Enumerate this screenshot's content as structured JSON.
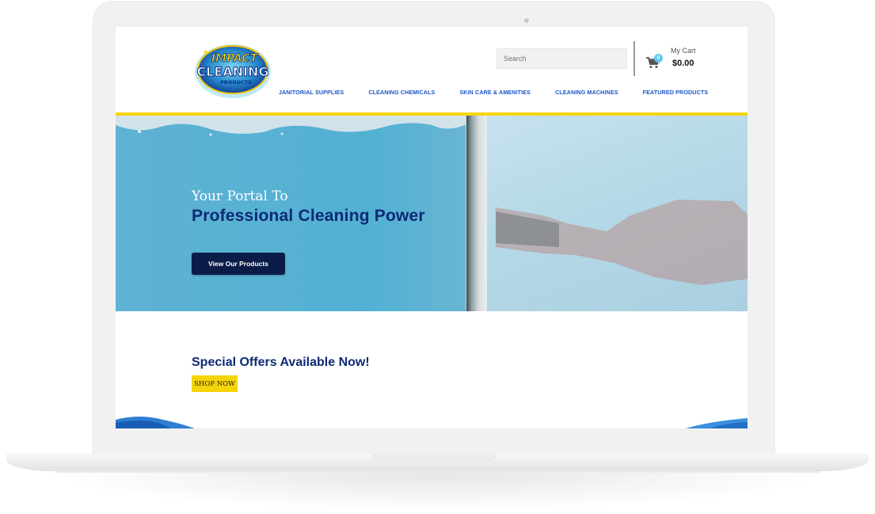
{
  "device": {
    "type": "laptop mockup"
  },
  "brand": {
    "logo_line1": "IMPACT",
    "logo_line2": "CLEANING",
    "logo_line3": "PRODUCTS",
    "colors": {
      "navy": "#0e2a74",
      "nav_blue": "#1b56c9",
      "yellow": "#f6d40a",
      "button_dark": "#0c1c48",
      "cart_badge": "#5ec8ef"
    }
  },
  "header": {
    "search": {
      "placeholder": "Search",
      "value": ""
    },
    "cart": {
      "label": "My Cart",
      "total": "$0.00",
      "count": "0",
      "icon": "shopping-cart-icon"
    }
  },
  "nav": {
    "items": [
      {
        "label": "JANITORIAL SUPPLIES"
      },
      {
        "label": "CLEANING CHEMICALS"
      },
      {
        "label": "SKIN CARE & AMENITIES"
      },
      {
        "label": "CLEANING MACHINES"
      },
      {
        "label": "FEATURED PRODUCTS"
      }
    ]
  },
  "hero": {
    "subtitle": "Your Portal To",
    "title": "Professional Cleaning Power",
    "button_label": "View Our Products"
  },
  "offers": {
    "title": "Special Offers Available Now!",
    "button_label": "SHOP NOW"
  }
}
